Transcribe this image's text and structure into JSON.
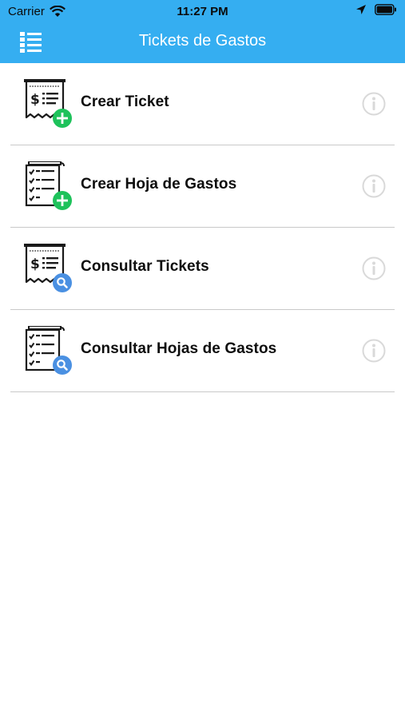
{
  "status_bar": {
    "carrier": "Carrier",
    "time": "11:27 PM",
    "icons": [
      "wifi-icon",
      "location-arrow-icon",
      "battery-icon"
    ]
  },
  "nav": {
    "title": "Tickets de Gastos",
    "menu_icon": "list-menu-icon"
  },
  "colors": {
    "header": "#35aef1",
    "add_badge": "#1ec25b",
    "search_badge": "#4a90e2",
    "info_icon": "#d9d9d9",
    "separator": "#c9c9c9"
  },
  "items": [
    {
      "label": "Crear Ticket",
      "icon": "receipt-add-icon"
    },
    {
      "label": "Crear Hoja de Gastos",
      "icon": "checklist-add-icon"
    },
    {
      "label": "Consultar Tickets",
      "icon": "receipt-search-icon"
    },
    {
      "label": "Consultar Hojas de Gastos",
      "icon": "checklist-search-icon"
    }
  ]
}
